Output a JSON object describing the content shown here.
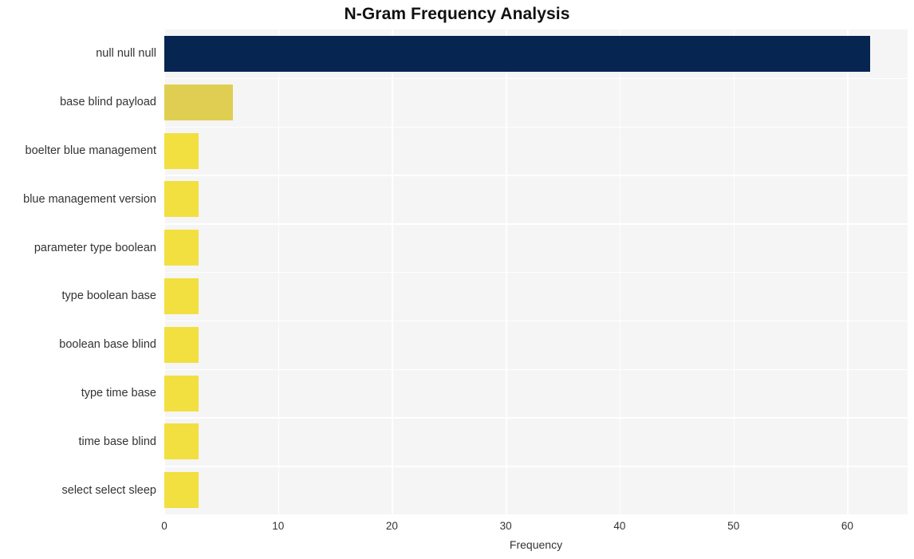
{
  "chart_data": {
    "type": "bar",
    "orientation": "horizontal",
    "title": "N-Gram Frequency Analysis",
    "xlabel": "Frequency",
    "ylabel": "",
    "xlim": [
      0,
      65.3
    ],
    "ylim": [
      0,
      10
    ],
    "grid": true,
    "legend": false,
    "categories": [
      "null null null",
      "base blind payload",
      "boelter blue management",
      "blue management version",
      "parameter type boolean",
      "type boolean base",
      "boolean base blind",
      "type time base",
      "time base blind",
      "select select sleep"
    ],
    "values": [
      62,
      6,
      3,
      3,
      3,
      3,
      3,
      3,
      3,
      3
    ],
    "bar_colors": [
      "#062551",
      "#e0ce52",
      "#f2df40",
      "#f2df40",
      "#f2df40",
      "#f2df40",
      "#f2df40",
      "#f2df40",
      "#f2df40",
      "#f2df40"
    ],
    "xticks": [
      0,
      10,
      20,
      30,
      40,
      50,
      60
    ],
    "xticklabels": [
      "0",
      "10",
      "20",
      "30",
      "40",
      "50",
      "60"
    ],
    "plot_background": "#f5f5f5",
    "figure_background": "#ffffff",
    "gridline_color": "#ffffff",
    "title_color": "#111111",
    "tick_color": "#333333"
  }
}
